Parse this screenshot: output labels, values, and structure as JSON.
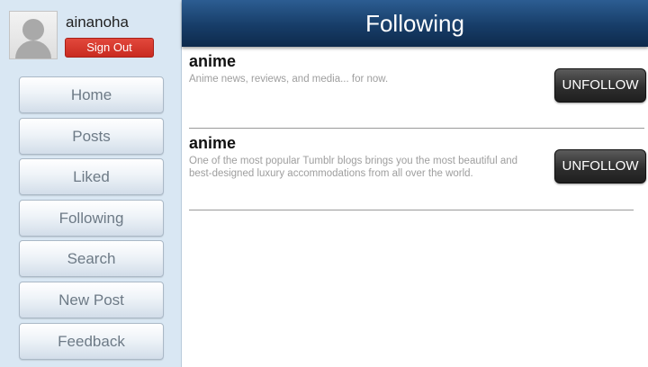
{
  "sidebar": {
    "username": "ainanoha",
    "sign_out_label": "Sign Out",
    "nav_items": [
      {
        "label": "Home"
      },
      {
        "label": "Posts"
      },
      {
        "label": "Liked"
      },
      {
        "label": "Following"
      },
      {
        "label": "Search"
      },
      {
        "label": "New Post"
      },
      {
        "label": "Feedback"
      }
    ]
  },
  "header": {
    "title": "Following"
  },
  "entries": [
    {
      "title": "anime",
      "description": "Anime news, reviews, and media... for now.",
      "button_label": "UNFOLLOW"
    },
    {
      "title": "anime",
      "description": "One of the most popular Tumblr blogs                                 brings you the most beautiful and best-designed luxury accommodations from all over the world.",
      "button_label": "UNFOLLOW"
    }
  ],
  "colors": {
    "header": "#173d68",
    "sidebar": "#d9e7f3",
    "sign_out": "#d2362a",
    "unfollow": "#2e2e2e"
  }
}
